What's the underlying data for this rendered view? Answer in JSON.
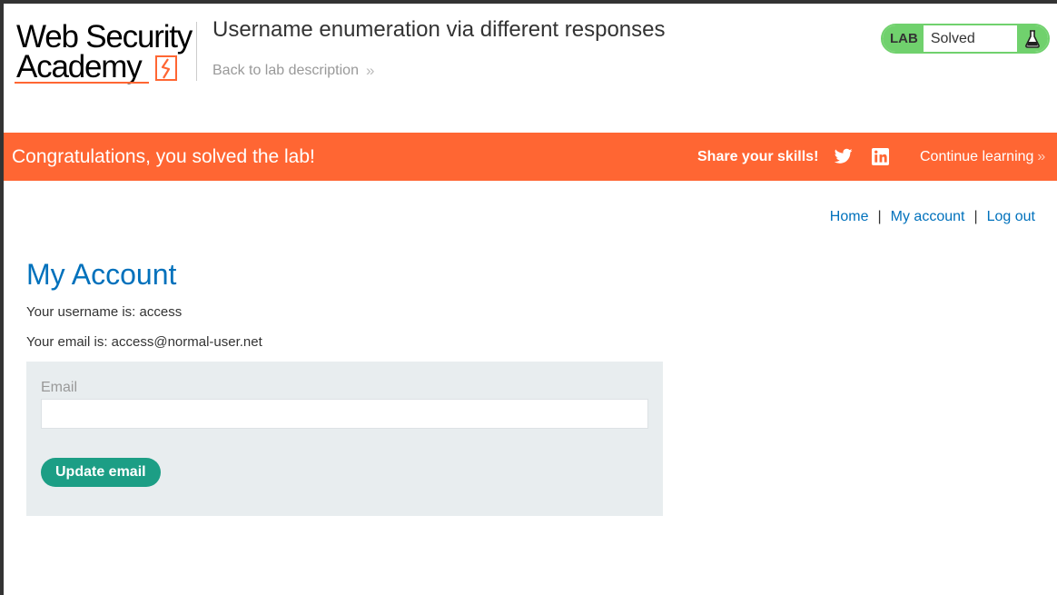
{
  "header": {
    "logo_line1": "Web Security",
    "logo_line2": "Academy",
    "lab_title": "Username enumeration via different responses",
    "back_link": "Back to lab description",
    "lab_badge": "LAB",
    "lab_status": "Solved"
  },
  "banner": {
    "message": "Congratulations, you solved the lab!",
    "share": "Share your skills!",
    "continue": "Continue learning"
  },
  "nav": {
    "home": "Home",
    "separator": "|",
    "my_account": "My account",
    "log_out": "Log out"
  },
  "main": {
    "title": "My Account",
    "username_line": "Your username is: access",
    "email_line": "Your email is: access@normal-user.net",
    "form": {
      "email_label": "Email",
      "email_value": "",
      "submit_label": "Update email"
    }
  },
  "colors": {
    "accent": "#ff6633",
    "link": "#0071bc",
    "solved_green": "#70d16d",
    "button": "#1c9e85"
  }
}
